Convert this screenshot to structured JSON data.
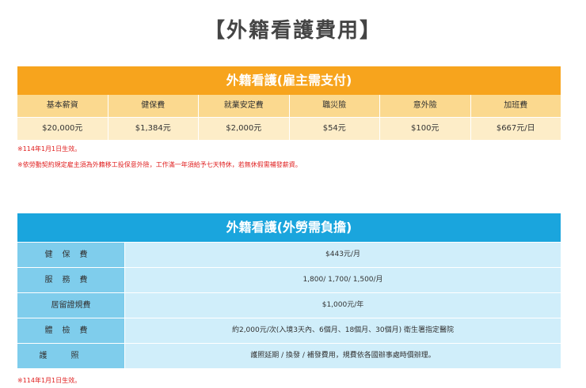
{
  "title": "【外籍看護費用】",
  "employer_table": {
    "caption": "外籍看護(雇主需支付)",
    "headers": [
      "基本薪資",
      "健保費",
      "就業安定費",
      "職災險",
      "意外險",
      "加班費"
    ],
    "values": [
      "$20,000元",
      "$1,384元",
      "$2,000元",
      "$54元",
      "$100元",
      "$667元/日"
    ],
    "notes": [
      "※114年1月1日生效。",
      "※依勞動契約規定雇主須為外籍移工投保意外險，工作滿一年須給予七天特休，若無休假需補發薪資。"
    ]
  },
  "worker_table": {
    "caption": "外籍看護(外勞需負擔)",
    "rows": [
      {
        "label": "健保費",
        "value": "$443元/月"
      },
      {
        "label": "服務費",
        "value": "1,800/ 1,700/ 1,500/月"
      },
      {
        "label": "居留證規費",
        "value": "$1,000元/年"
      },
      {
        "label": "體檢費",
        "value": "約2,000元/次(入境3天內、6個月、18個月、30個月) 衛生署指定醫院"
      },
      {
        "label": "護照",
        "value": "護照延期 / 換發 / 補發費用，規費依各國辦事處時價辦理。"
      }
    ],
    "note": "※114年1月1日生效。"
  }
}
